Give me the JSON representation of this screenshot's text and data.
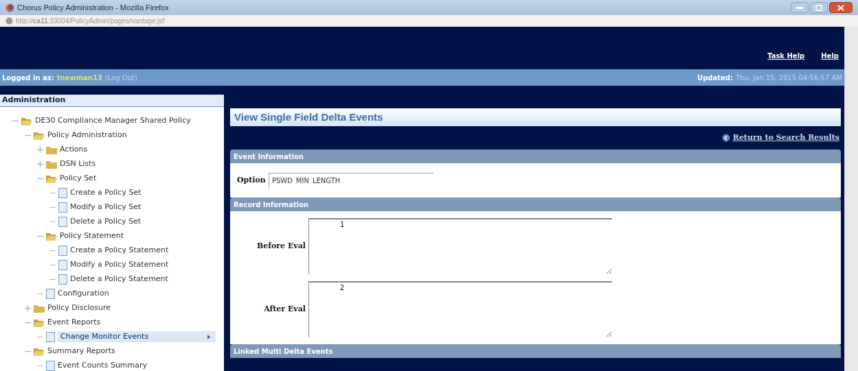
{
  "window": {
    "title": "Chorus Policy Administration - Mozilla Firefox",
    "url": "http://**ca11**:33004/PolicyAdmin/pages/vantage.jsf"
  },
  "header": {
    "links": [
      "Task Help",
      "Help"
    ],
    "logged_in_label": "Logged in as:",
    "user": "tnewman13",
    "logout": "(Log Out)",
    "updated_label": "Updated:",
    "updated_value": "Thu, Jan 15, 2015 04:56:57 AM"
  },
  "sidebar": {
    "title": "Administration",
    "tree": [
      {
        "label": "DE30 Compliance Manager Shared Policy",
        "kind": "folder",
        "expanded": true,
        "selected": false,
        "children": [
          {
            "label": "Policy Administration",
            "kind": "folder",
            "expanded": true,
            "selected": false,
            "children": [
              {
                "label": "Actions",
                "kind": "folder",
                "expanded": false,
                "selected": false
              },
              {
                "label": "DSN Lists",
                "kind": "folder",
                "expanded": false,
                "selected": false
              },
              {
                "label": "Policy Set",
                "kind": "folder",
                "expanded": true,
                "selected": false,
                "children": [
                  {
                    "label": "Create a Policy Set",
                    "kind": "page",
                    "selected": false
                  },
                  {
                    "label": "Modify a Policy Set",
                    "kind": "page",
                    "selected": false
                  },
                  {
                    "label": "Delete a Policy Set",
                    "kind": "page",
                    "selected": false
                  }
                ]
              },
              {
                "label": "Policy Statement",
                "kind": "folder",
                "expanded": true,
                "selected": false,
                "children": [
                  {
                    "label": "Create a Policy Statement",
                    "kind": "page",
                    "selected": false
                  },
                  {
                    "label": "Modify a Policy Statement",
                    "kind": "page",
                    "selected": false
                  },
                  {
                    "label": "Delete a Policy Statement",
                    "kind": "page",
                    "selected": false
                  }
                ]
              },
              {
                "label": "Configuration",
                "kind": "page",
                "selected": false
              }
            ]
          },
          {
            "label": "Policy Disclosure",
            "kind": "folder",
            "expanded": false,
            "selected": false
          },
          {
            "label": "Event Reports",
            "kind": "folder",
            "expanded": true,
            "selected": false,
            "children": [
              {
                "label": "Change Monitor Events",
                "kind": "page",
                "selected": true
              }
            ]
          },
          {
            "label": "Summary Reports",
            "kind": "folder",
            "expanded": true,
            "selected": false,
            "children": [
              {
                "label": "Event Counts Summary",
                "kind": "page",
                "selected": false
              }
            ]
          }
        ]
      }
    ]
  },
  "main": {
    "title": "View Single Field Delta Events",
    "return_link": "Return to Search Results",
    "sections": [
      {
        "title": "Event Information",
        "fields": [
          {
            "label": "Option",
            "kind": "input",
            "value": "PSWD_MIN_LENGTH"
          }
        ]
      },
      {
        "title": "Record Information",
        "fields": [
          {
            "label": "Before Eval",
            "kind": "textarea",
            "value": "1"
          },
          {
            "label": "After Eval",
            "kind": "textarea",
            "value": "2"
          }
        ]
      },
      {
        "title": "Linked Multi Delta Events"
      }
    ]
  }
}
